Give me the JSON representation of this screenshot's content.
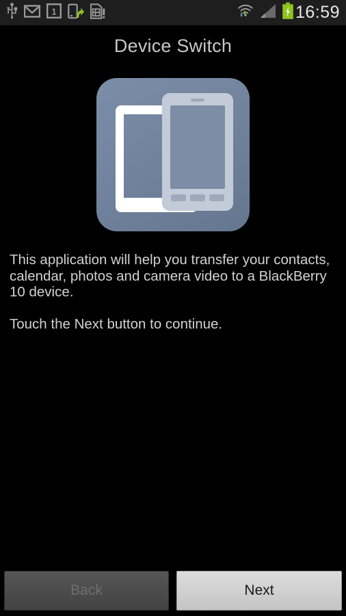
{
  "status_bar": {
    "time": "16:59",
    "left_icons": [
      {
        "name": "usb-icon",
        "label": "USB connected"
      },
      {
        "name": "gmail-icon",
        "label": "Gmail notification"
      },
      {
        "name": "calendar-one-icon",
        "label": "Calendar event 1"
      },
      {
        "name": "phone-transfer-icon",
        "label": "Device transfer"
      },
      {
        "name": "sim-card-alert-icon",
        "label": "SIM card alert"
      }
    ],
    "right_icons": [
      {
        "name": "wifi-icon",
        "label": "Wi-Fi connected with activity"
      },
      {
        "name": "signal-bars-icon",
        "label": "Mobile signal"
      },
      {
        "name": "battery-charging-icon",
        "label": "Battery charging"
      }
    ],
    "colors": {
      "background": "#1e1e1e",
      "icon": "#9a9a9a",
      "accent_green": "#8fc31f",
      "time": "#e8e8e8"
    }
  },
  "header": {
    "title": "Device Switch"
  },
  "app_icon": {
    "name": "device-switch-app-icon",
    "alt": "Two overlapping smartphones",
    "background_color": "#73849f",
    "back_phone_color": "#ffffff",
    "front_phone_color": "#c3cbd8"
  },
  "main": {
    "paragraphs": [
      "This application will help you transfer your contacts, calendar, photos and camera video to a BlackBerry 10 device.",
      "Touch the Next button to continue."
    ]
  },
  "footer": {
    "back_label": "Back",
    "next_label": "Next",
    "back_enabled": false,
    "next_enabled": true
  }
}
